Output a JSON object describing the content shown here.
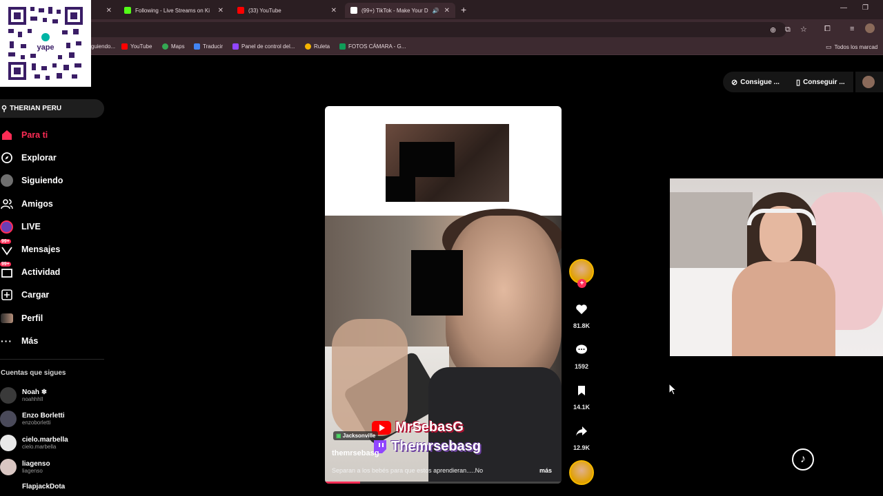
{
  "browser": {
    "tabs": [
      {
        "label": "",
        "favicon_color": "#2b1e22"
      },
      {
        "label": "Following - Live Streams on Ki",
        "favicon_color": "#53fc18"
      },
      {
        "label": "(33) YouTube",
        "favicon_color": "#ff0000"
      },
      {
        "label": "(99+) TikTok - Make Your D",
        "favicon_color": "#ffffff"
      }
    ],
    "new_tab": "+",
    "bookmarks": [
      {
        "label": "guiendo...",
        "color": "#8a8a8a"
      },
      {
        "label": "YouTube",
        "color": "#ff0000"
      },
      {
        "label": "Maps",
        "color": "#34a853"
      },
      {
        "label": "Traducir",
        "color": "#4285f4"
      },
      {
        "label": "Panel de control del...",
        "color": "#9146ff"
      },
      {
        "label": "Ruleta",
        "color": "#f4b400"
      },
      {
        "label": "FOTOS CÁMARA - G...",
        "color": "#0f9d58"
      }
    ],
    "all_bookmarks": "Todos los marcad"
  },
  "overlay": {
    "qr_brand": "yape"
  },
  "sidebar": {
    "search_text": "THERIAN PERU",
    "nav": [
      {
        "label": "Para ti",
        "icon": "home-icon",
        "active": true
      },
      {
        "label": "Explorar",
        "icon": "compass-icon"
      },
      {
        "label": "Siguiendo",
        "icon": "avatar-icon"
      },
      {
        "label": "Amigos",
        "icon": "friends-icon"
      },
      {
        "label": "LIVE",
        "icon": "live-icon"
      },
      {
        "label": "Mensajes",
        "icon": "inbox-icon",
        "badge": "99+"
      },
      {
        "label": "Actividad",
        "icon": "activity-icon",
        "badge": "99+"
      },
      {
        "label": "Cargar",
        "icon": "upload-icon"
      },
      {
        "label": "Perfil",
        "icon": "profile-icon"
      },
      {
        "label": "Más",
        "icon": "more-icon"
      }
    ],
    "following_header": "Cuentas que sigues",
    "following": [
      {
        "name": "Noah ❄",
        "handle": "noahhhll"
      },
      {
        "name": "Enzo Borletti",
        "handle": "enzoborletti"
      },
      {
        "name": "cielo.marbella",
        "handle": "cielo.marbella"
      },
      {
        "name": "liagenso",
        "handle": "liagenso"
      },
      {
        "name": "FlapjackDota",
        "handle": ""
      }
    ]
  },
  "header": {
    "get_coins": "Consigue ...",
    "get_app": "Conseguir ..."
  },
  "video": {
    "username": "themrsebasg",
    "location": "Jacksonville",
    "caption": "Separan a los bebés para que estos aprendieran.....No",
    "more": "más",
    "overlay_youtube": "MrSebasG",
    "overlay_twitch": "Themrsebasg",
    "progress": 0.15
  },
  "actions": {
    "likes": "81.8K",
    "comments": "1592",
    "saves": "14.1K",
    "shares": "12.9K"
  },
  "colors": {
    "accent": "#fe2c55",
    "chrome": "#3d2a30"
  }
}
